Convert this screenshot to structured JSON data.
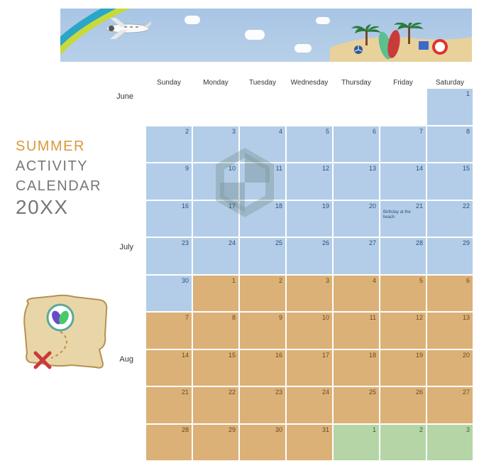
{
  "title": {
    "line1": "SUMMER",
    "line2": "ACTIVITY",
    "line3": "CALENDAR",
    "year": "20XX"
  },
  "days_of_week": [
    "Sunday",
    "Monday",
    "Tuesday",
    "Wednesday",
    "Thursday",
    "Friday",
    "Saturday"
  ],
  "months": {
    "june": "June",
    "july": "July",
    "aug": "Aug"
  },
  "calendar_rows": [
    {
      "cells": [
        {
          "n": "",
          "month": "blank"
        },
        {
          "n": "",
          "month": "blank"
        },
        {
          "n": "",
          "month": "blank"
        },
        {
          "n": "",
          "month": "blank"
        },
        {
          "n": "",
          "month": "blank"
        },
        {
          "n": "",
          "month": "blank"
        },
        {
          "n": "1",
          "month": "june"
        }
      ]
    },
    {
      "cells": [
        {
          "n": "2",
          "month": "june"
        },
        {
          "n": "3",
          "month": "june"
        },
        {
          "n": "4",
          "month": "june"
        },
        {
          "n": "5",
          "month": "june"
        },
        {
          "n": "6",
          "month": "june"
        },
        {
          "n": "7",
          "month": "june"
        },
        {
          "n": "8",
          "month": "june"
        }
      ]
    },
    {
      "cells": [
        {
          "n": "9",
          "month": "june"
        },
        {
          "n": "10",
          "month": "june"
        },
        {
          "n": "11",
          "month": "june"
        },
        {
          "n": "12",
          "month": "june"
        },
        {
          "n": "13",
          "month": "june"
        },
        {
          "n": "14",
          "month": "june"
        },
        {
          "n": "15",
          "month": "june"
        }
      ]
    },
    {
      "cells": [
        {
          "n": "16",
          "month": "june"
        },
        {
          "n": "17",
          "month": "june"
        },
        {
          "n": "18",
          "month": "june"
        },
        {
          "n": "19",
          "month": "june"
        },
        {
          "n": "20",
          "month": "june"
        },
        {
          "n": "21",
          "month": "june",
          "note": "Birthday at the beach"
        },
        {
          "n": "22",
          "month": "june"
        }
      ]
    },
    {
      "cells": [
        {
          "n": "23",
          "month": "june"
        },
        {
          "n": "24",
          "month": "june"
        },
        {
          "n": "25",
          "month": "june"
        },
        {
          "n": "26",
          "month": "june"
        },
        {
          "n": "27",
          "month": "june"
        },
        {
          "n": "28",
          "month": "june"
        },
        {
          "n": "29",
          "month": "june"
        }
      ]
    },
    {
      "cells": [
        {
          "n": "30",
          "month": "june"
        },
        {
          "n": "1",
          "month": "july"
        },
        {
          "n": "2",
          "month": "july"
        },
        {
          "n": "3",
          "month": "july"
        },
        {
          "n": "4",
          "month": "july"
        },
        {
          "n": "5",
          "month": "july"
        },
        {
          "n": "6",
          "month": "july"
        }
      ]
    },
    {
      "cells": [
        {
          "n": "7",
          "month": "july"
        },
        {
          "n": "8",
          "month": "july"
        },
        {
          "n": "9",
          "month": "july"
        },
        {
          "n": "10",
          "month": "july"
        },
        {
          "n": "11",
          "month": "july"
        },
        {
          "n": "12",
          "month": "july"
        },
        {
          "n": "13",
          "month": "july"
        }
      ]
    },
    {
      "cells": [
        {
          "n": "14",
          "month": "july"
        },
        {
          "n": "15",
          "month": "july"
        },
        {
          "n": "16",
          "month": "july"
        },
        {
          "n": "17",
          "month": "july"
        },
        {
          "n": "18",
          "month": "july"
        },
        {
          "n": "19",
          "month": "july"
        },
        {
          "n": "20",
          "month": "july"
        }
      ]
    },
    {
      "cells": [
        {
          "n": "21",
          "month": "july"
        },
        {
          "n": "22",
          "month": "july"
        },
        {
          "n": "23",
          "month": "july"
        },
        {
          "n": "24",
          "month": "july"
        },
        {
          "n": "25",
          "month": "july"
        },
        {
          "n": "26",
          "month": "july"
        },
        {
          "n": "27",
          "month": "july"
        }
      ]
    },
    {
      "cells": [
        {
          "n": "28",
          "month": "july"
        },
        {
          "n": "29",
          "month": "july"
        },
        {
          "n": "30",
          "month": "july"
        },
        {
          "n": "31",
          "month": "july"
        },
        {
          "n": "1",
          "month": "aug"
        },
        {
          "n": "2",
          "month": "aug"
        },
        {
          "n": "3",
          "month": "aug"
        }
      ]
    }
  ]
}
